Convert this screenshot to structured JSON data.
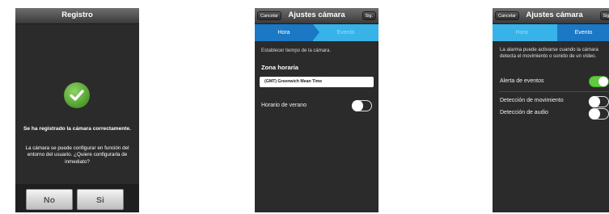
{
  "screen1": {
    "title": "Registro",
    "success_bold": "Se ha registrado la cámara correctamente.",
    "message": "La cámara se puede configurar en función del entorno del usuario. ¿Quiere configurarla de inmediato?",
    "no_label": "No",
    "yes_label": "Si"
  },
  "screen2": {
    "title": "Ajustes cámara",
    "cancel_label": "Cancelar",
    "next_label": "Sig.",
    "tab_hour": "Hora",
    "tab_event": "Evento",
    "intro": "Establecer tiempo de la cámara.",
    "zone_heading": "Zona horaria",
    "zone_value": "(GMT) Greenwich Mean Time",
    "dst_label": "Horario de verano",
    "dst_on": false
  },
  "screen3": {
    "title": "Ajustes cámara",
    "cancel_label": "Cancelar",
    "next_label": "Sig.",
    "tab_hour": "Hora",
    "tab_event": "Evento",
    "description": "La alarma puede activarse cuando la cámara detecta el movimiento o sonido de un vídeo.",
    "event_alert_label": "Alerta de eventos",
    "event_alert_on": true,
    "motion_label": "Detección de movimiento",
    "motion_on": false,
    "audio_label": "Detección de audio",
    "audio_on": false
  },
  "colors": {
    "tab_light": "#37b3e8",
    "tab_dark": "#1b78c4",
    "toggle_on": "#5fcc3e"
  }
}
